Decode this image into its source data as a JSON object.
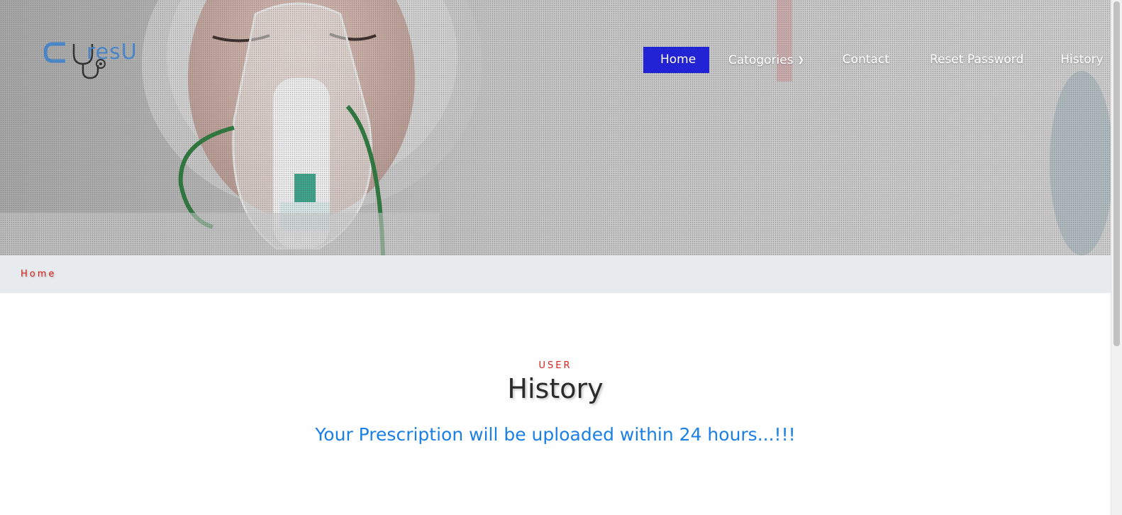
{
  "logo": {
    "text": "resU",
    "brand_color": "#4a86c5",
    "icon": "stethoscope-icon"
  },
  "nav": {
    "active_color": "#2323d6",
    "items": [
      {
        "label": "Home",
        "active": true
      },
      {
        "label": "Catogories",
        "has_dropdown": true,
        "dropdown_icon": "chevron-down-icon"
      },
      {
        "label": "Contact"
      },
      {
        "label": "Reset Password"
      },
      {
        "label": "History"
      }
    ]
  },
  "breadcrumb": {
    "home": "Home",
    "color": "#d9231d"
  },
  "section": {
    "label": "USER",
    "title": "History",
    "message": "Your Prescription will be uploaded within 24 hours...!!!",
    "message_color": "#1a7fe6"
  }
}
